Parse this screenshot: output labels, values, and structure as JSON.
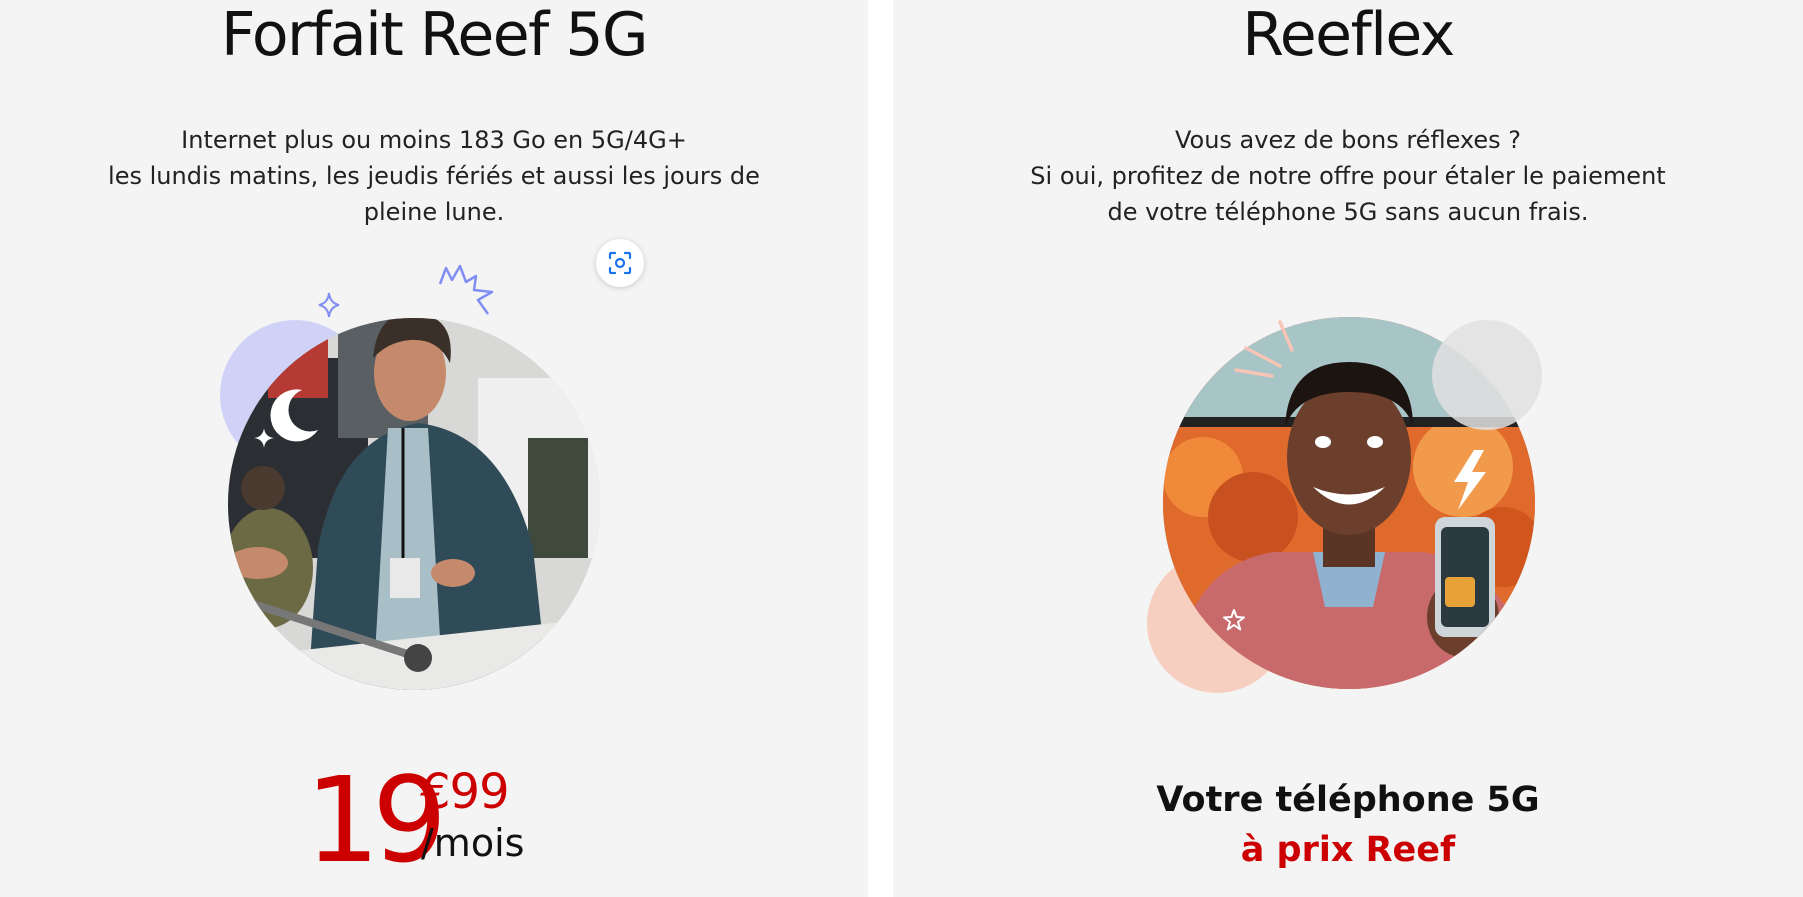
{
  "left": {
    "title": "Forfait Reef 5G",
    "description": [
      "Internet plus ou moins 183 Go en 5G/4G+",
      "les lundis matins, les jeudis fériés et aussi les jours de",
      "pleine lune."
    ],
    "price": {
      "integer": "19",
      "cents": "€99",
      "unit": "/mois"
    },
    "scan_icon": "scan-icon",
    "image_icon": "man-presenting-photo"
  },
  "right": {
    "title": "Reeflex",
    "description": [
      "Vous avez de bons réflexes ?",
      "Si oui, profitez de notre offre pour étaler le paiement",
      "de votre téléphone 5G sans aucun frais."
    ],
    "headline": "Votre téléphone 5G",
    "subheadline": "à prix Reef",
    "image_icon": "man-with-phone-photo"
  },
  "colors": {
    "accent_red": "#cc0000",
    "panel_bg": "#f4f4f4",
    "lilac": "#cfd2f6",
    "peach": "#f6cfc0"
  }
}
